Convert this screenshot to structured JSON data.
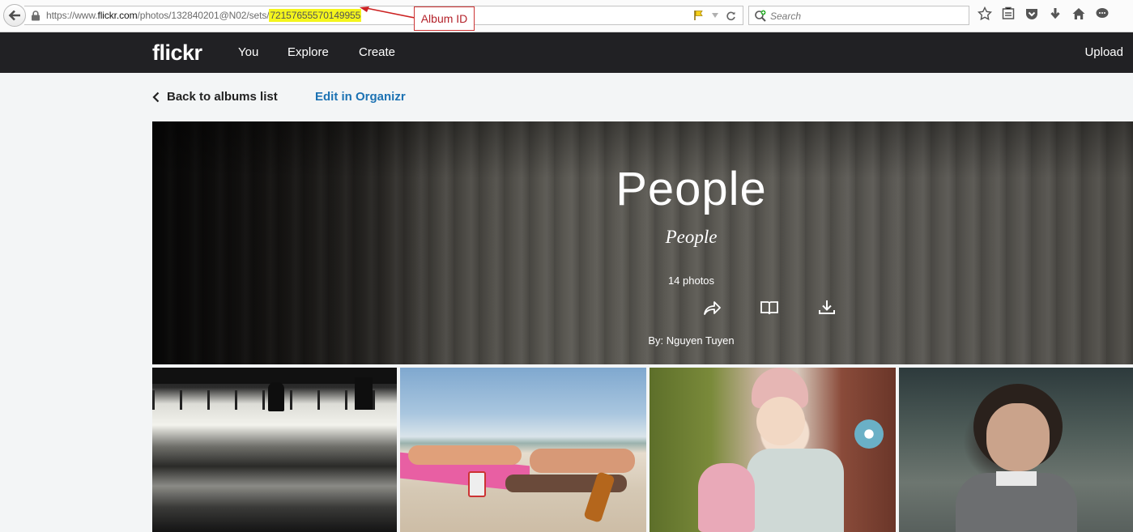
{
  "browser": {
    "url_prefix": "https://www.",
    "url_host": "flickr.com",
    "url_path": "/photos/132840201@N02/sets/",
    "url_album_id": "72157655570149955",
    "search_placeholder": "Search"
  },
  "annotation": {
    "label": "Album ID",
    "color": "#b4222a"
  },
  "nav": {
    "logo": "flickr",
    "links": [
      "You",
      "Explore",
      "Create"
    ],
    "upload": "Upload"
  },
  "subnav": {
    "back_label": "Back to albums list",
    "edit_label": "Edit in Organizr",
    "edit_color": "#1c72b3"
  },
  "album": {
    "title": "People",
    "description": "People",
    "count": "14 photos",
    "by": "By: Nguyen Tuyen",
    "actions": [
      "share-icon",
      "book-icon",
      "download-icon"
    ]
  },
  "photos": [
    {
      "name": "airport-silhouette-photo"
    },
    {
      "name": "beach-sunbathers-photo"
    },
    {
      "name": "girl-rocking-horse-photo"
    },
    {
      "name": "curly-hair-boy-photo"
    }
  ]
}
